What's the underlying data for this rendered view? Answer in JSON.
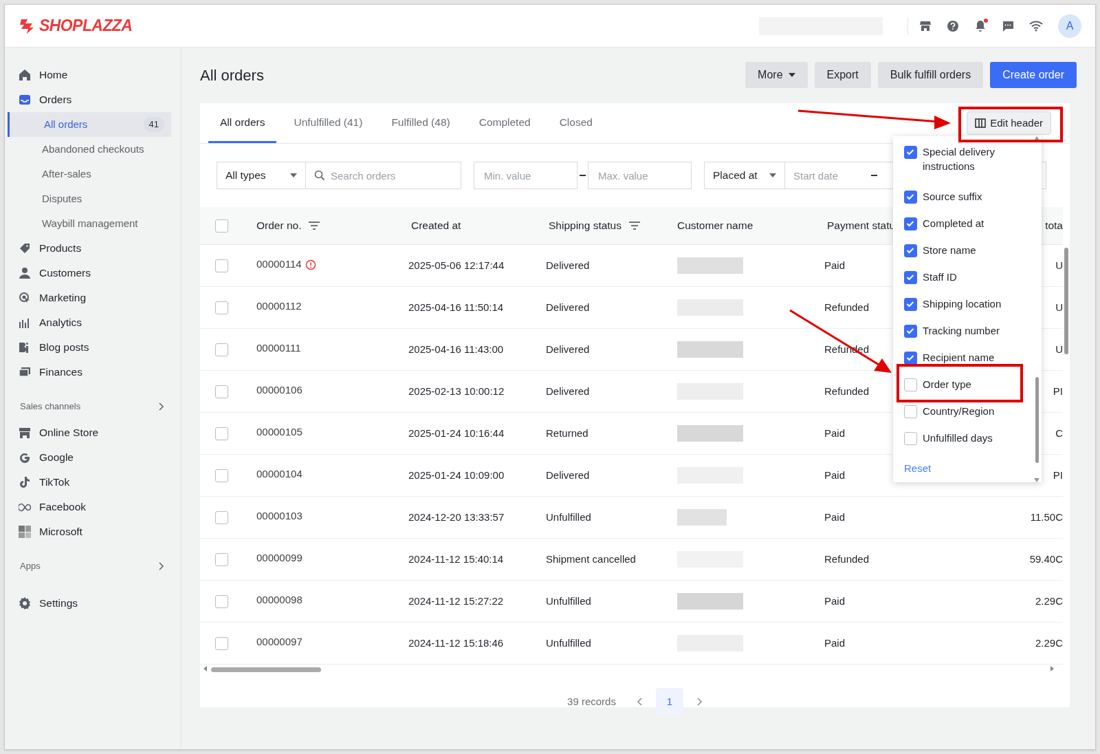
{
  "brand": {
    "name": "SHOPLAZZA"
  },
  "topbar": {
    "avatar": "A",
    "notification_dot": true
  },
  "sidebar": {
    "sections": [
      {
        "items": [
          {
            "label": "Home",
            "selected": false
          },
          {
            "label": "Orders",
            "selected": false,
            "expanded": true,
            "children": [
              {
                "label": "All orders",
                "count": "41",
                "selected": true
              },
              {
                "label": "Abandoned checkouts",
                "selected": false
              },
              {
                "label": "After-sales",
                "selected": false
              },
              {
                "label": "Disputes",
                "selected": false
              },
              {
                "label": "Waybill management",
                "selected": false
              }
            ]
          },
          {
            "label": "Products",
            "selected": false
          },
          {
            "label": "Customers",
            "selected": false
          },
          {
            "label": "Marketing",
            "selected": false
          },
          {
            "label": "Analytics",
            "selected": false
          },
          {
            "label": "Blog posts",
            "selected": false
          },
          {
            "label": "Finances",
            "selected": false
          }
        ]
      },
      {
        "heading": "Sales channels",
        "items": [
          {
            "label": "Online Store",
            "selected": false
          },
          {
            "label": "Google",
            "selected": false
          },
          {
            "label": "TikTok",
            "selected": false
          },
          {
            "label": "Facebook",
            "selected": false
          },
          {
            "label": "Microsoft",
            "selected": false
          }
        ]
      },
      {
        "heading": "Apps"
      },
      {
        "items": [
          {
            "label": "Settings",
            "selected": false
          }
        ]
      }
    ]
  },
  "page": {
    "title": "All orders",
    "buttons": [
      {
        "label": "More",
        "kind": "menu"
      },
      {
        "label": "Export",
        "kind": "plain"
      },
      {
        "label": "Bulk fulfill orders",
        "kind": "plain"
      },
      {
        "label": "Create order",
        "kind": "primary"
      }
    ]
  },
  "tabs": [
    {
      "label": "All orders",
      "selected": true
    },
    {
      "label": "Unfulfilled (41)",
      "selected": false
    },
    {
      "label": "Fulfilled (48)",
      "selected": false
    },
    {
      "label": "Completed",
      "selected": false
    },
    {
      "label": "Closed",
      "selected": false
    }
  ],
  "edit_header_button": {
    "label": "Edit header"
  },
  "filters": {
    "type_select": "All types",
    "search": {
      "placeholder": "Search orders"
    },
    "min": {
      "placeholder": "Min. value"
    },
    "max": {
      "placeholder": "Max. value"
    },
    "date_select": "Placed at",
    "start_date": {
      "placeholder": "Start date"
    }
  },
  "table": {
    "select_all": {
      "checked": false
    },
    "columns": [
      {
        "label": "Order no.",
        "filterable": true
      },
      {
        "label": "Created at",
        "filterable": false
      },
      {
        "label": "Shipping status",
        "filterable": true
      },
      {
        "label": "Customer name",
        "filterable": false
      },
      {
        "label": "Payment statu"
      },
      {
        "label": "tota",
        "filterable": false
      }
    ],
    "rows": [
      {
        "selected": false,
        "order": "00000114",
        "warning": true,
        "created": "2025-05-06 12:17:44",
        "shipping": "Delivered",
        "payment": "Paid",
        "total": "U"
      },
      {
        "selected": false,
        "order": "00000112",
        "warning": false,
        "created": "2025-04-16 11:50:14",
        "shipping": "Delivered",
        "payment": "Refunded",
        "total": "U"
      },
      {
        "selected": false,
        "order": "00000111",
        "warning": false,
        "created": "2025-04-16 11:43:00",
        "shipping": "Delivered",
        "payment": "Refunded",
        "total": "U"
      },
      {
        "selected": false,
        "order": "00000106",
        "warning": false,
        "created": "2025-02-13 10:00:12",
        "shipping": "Delivered",
        "payment": "Refunded",
        "total": "PI"
      },
      {
        "selected": false,
        "order": "00000105",
        "warning": false,
        "created": "2025-01-24 10:16:44",
        "shipping": "Returned",
        "payment": "Paid",
        "total": "C"
      },
      {
        "selected": false,
        "order": "00000104",
        "warning": false,
        "created": "2025-01-24 10:09:00",
        "shipping": "Delivered",
        "payment": "Paid",
        "total": "PI"
      },
      {
        "selected": false,
        "order": "00000103",
        "warning": false,
        "created": "2024-12-20 13:33:57",
        "shipping": "Unfulfilled",
        "payment": "Paid",
        "total": "11.50C"
      },
      {
        "selected": false,
        "order": "00000099",
        "warning": false,
        "created": "2024-11-12 15:40:14",
        "shipping": "Shipment cancelled",
        "payment": "Refunded",
        "total": "59.40C"
      },
      {
        "selected": false,
        "order": "00000098",
        "warning": false,
        "created": "2024-11-12 15:27:22",
        "shipping": "Unfulfilled",
        "payment": "Paid",
        "total": "2.29C"
      },
      {
        "selected": false,
        "order": "00000097",
        "warning": false,
        "created": "2024-11-12 15:18:46",
        "shipping": "Unfulfilled",
        "payment": "Paid",
        "total": "2.29C"
      }
    ]
  },
  "pagination": {
    "records": "39 records",
    "pages": [
      {
        "label": "1",
        "selected": true
      }
    ]
  },
  "header_menu": {
    "columns": [
      {
        "label": "Special delivery instructions",
        "checked": true
      },
      {
        "label": "Source suffix",
        "checked": true
      },
      {
        "label": "Completed at",
        "checked": true
      },
      {
        "label": "Store name",
        "checked": true
      },
      {
        "label": "Staff ID",
        "checked": true
      },
      {
        "label": "Shipping location",
        "checked": true
      },
      {
        "label": "Tracking number",
        "checked": true
      },
      {
        "label": "Recipient name",
        "checked": true
      },
      {
        "label": "Order type",
        "checked": false
      },
      {
        "label": "Country/Region",
        "checked": false
      },
      {
        "label": "Unfulfilled days",
        "checked": false
      }
    ],
    "reset": "Reset"
  }
}
